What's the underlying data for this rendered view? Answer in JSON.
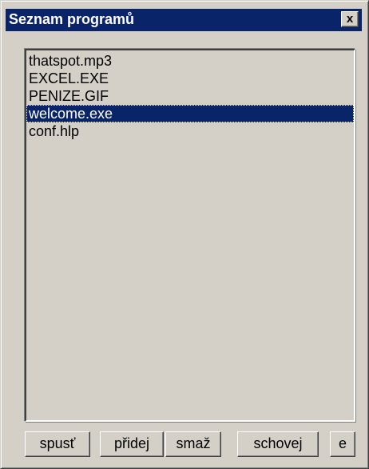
{
  "window": {
    "title": "Seznam programů",
    "close_label": "x"
  },
  "list": {
    "items": [
      "thatspot.mp3",
      "EXCEL.EXE",
      "PENIZE.GIF",
      "welcome.exe",
      "conf.hlp"
    ],
    "selected_item": "welcome.exe"
  },
  "buttons": {
    "run_label": "spusť",
    "add_label": "přidej",
    "delete_label": "smaž",
    "hide_label": "schovej",
    "e_label": "e"
  },
  "colors": {
    "titlebar": "#0a246a",
    "face": "#d4d0c8",
    "selection": "#0a246a"
  }
}
